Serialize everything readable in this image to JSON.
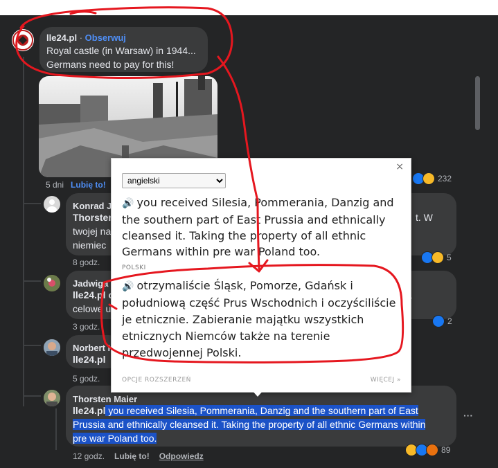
{
  "post": {
    "author": "lle24.pl",
    "separator": " · ",
    "follow_label": "Obserwuj",
    "line1": "Royal castle (in Warsaw) in 1944...",
    "line2": "Germans need to pay for this!",
    "time": "5 dni",
    "like_label": "Lubię to!",
    "reaction_count": "232"
  },
  "comments": [
    {
      "author": "Konrad Je",
      "line1": "Thorsten",
      "line1_right": "t. W",
      "line2": "twojej na",
      "line3": "niemiec",
      "time": "8 godz.",
      "reaction_count": "5"
    },
    {
      "author": "Jadwiga G",
      "line1": "lle24.pl o",
      "line1_right": "a",
      "line2": "celowe u",
      "time": "3 godz.",
      "reaction_count": "2"
    },
    {
      "author": "Norbert K",
      "line1": "lle24.pl",
      "time": "5 godz."
    },
    {
      "author": "Thorsten Maier",
      "mention": "lle24.pl",
      "text_line1": " you received Silesia, Pommerania, Danzig and the southern part of East",
      "text_line2": "Prussia and ethnically cleansed it. Taking the property of all ethnic Germans within",
      "text_line3": "pre war Poland too.",
      "time": "12 godz.",
      "like_label": "Lubię to!",
      "reply_label": "Odpowiedz",
      "reaction_count": "89",
      "more_label": "···"
    }
  ],
  "popup": {
    "close": "×",
    "source_language": "angielski",
    "speaker_glyph": "🔊",
    "source_text": "you received Silesia, Pommerania, Danzig and the southern part of East Prussia and ethnically cleansed it. Taking the property of all ethnic Germans within pre war Poland too.",
    "target_label": "POLSKI",
    "target_text": "otrzymaliście Śląsk, Pomorze, Gdańsk i południową część Prus Wschodnich i oczyściliście je etnicznie. Zabieranie majątku wszystkich etnicznych Niemców także na terenie przedwojennej Polski.",
    "options_label": "OPCJE ROZSZERZEŃ",
    "more_label": "WIĘCEJ »"
  },
  "colors": {
    "background": "#242526",
    "bubble": "#3a3b3c",
    "link_blue": "#4f8ff7",
    "highlight": "#1b52c7",
    "scribble_red": "#e5171f"
  }
}
